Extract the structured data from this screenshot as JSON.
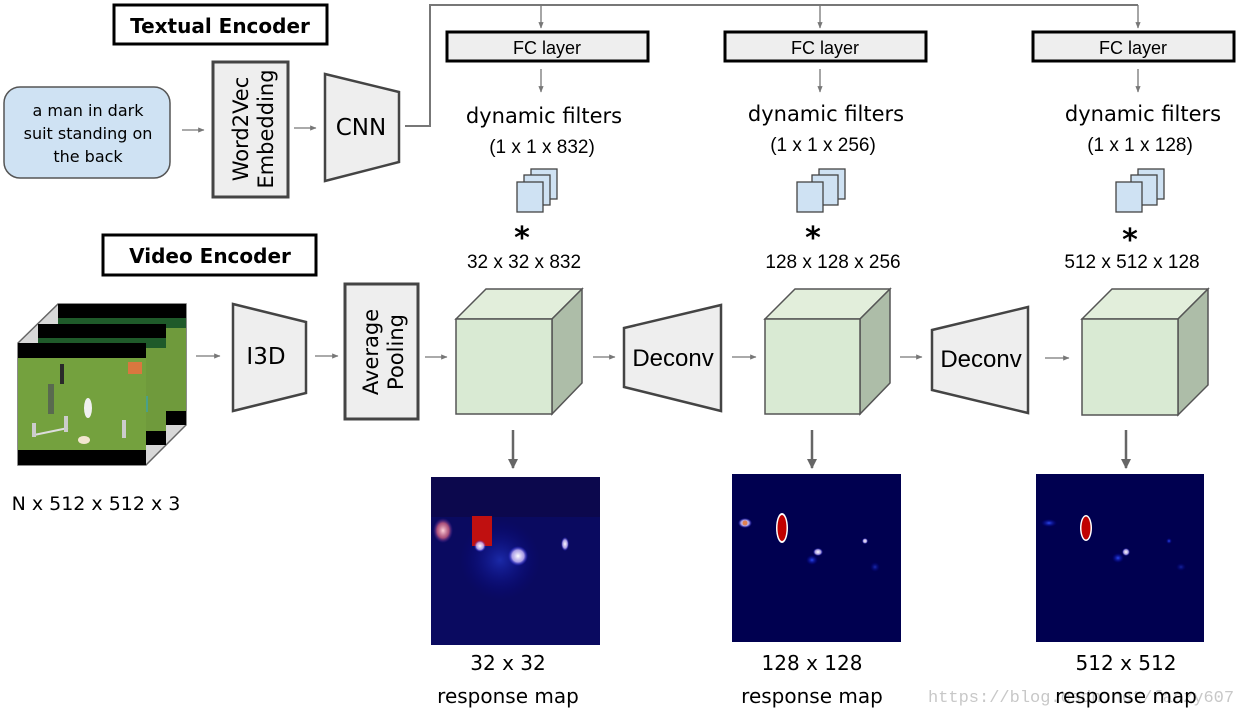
{
  "textual_encoder": {
    "title": "Textual Encoder",
    "query": [
      "a man in dark",
      "suit standing on",
      "the back"
    ],
    "embedding": [
      "Word2Vec",
      "Embedding"
    ],
    "cnn": "CNN"
  },
  "video_encoder": {
    "title": "Video Encoder",
    "input_dims": "N x 512 x 512 x 3",
    "i3d": "I3D",
    "pooling": [
      "Average",
      "Pooling"
    ]
  },
  "stages": [
    {
      "fc": "FC layer",
      "filters_title": "dynamic filters",
      "filters_dims": "(1 x 1 x 832)",
      "conv_symbol": "*",
      "feature_dims": "32 x 32 x 832",
      "map_size": "32 x 32",
      "map_label": "response map"
    },
    {
      "fc": "FC layer",
      "filters_title": "dynamic filters",
      "filters_dims": "(1 x 1 x 256)",
      "conv_symbol": "*",
      "feature_dims": "128 x 128 x 256",
      "map_size": "128 x 128",
      "map_label": "response map"
    },
    {
      "fc": "FC layer",
      "filters_title": "dynamic filters",
      "filters_dims": "(1 x 1 x 128)",
      "conv_symbol": "*",
      "feature_dims": "512 x 512 x 128",
      "map_size": "512 x 512",
      "map_label": "response map"
    }
  ],
  "deconv": [
    "Deconv",
    "Deconv"
  ],
  "watermark": "https://blog.csdn.net/fanzy607",
  "colors": {
    "query_fill": "#cfe2f3",
    "block_fill": "#eeeeee",
    "cube_front": "#d9ead3",
    "cube_top": "#e2eedb",
    "cube_side": "#adbda8",
    "filter_fill": "#cfe2f3",
    "heatmap_bg": "#00004a",
    "arrow": "#666666"
  }
}
